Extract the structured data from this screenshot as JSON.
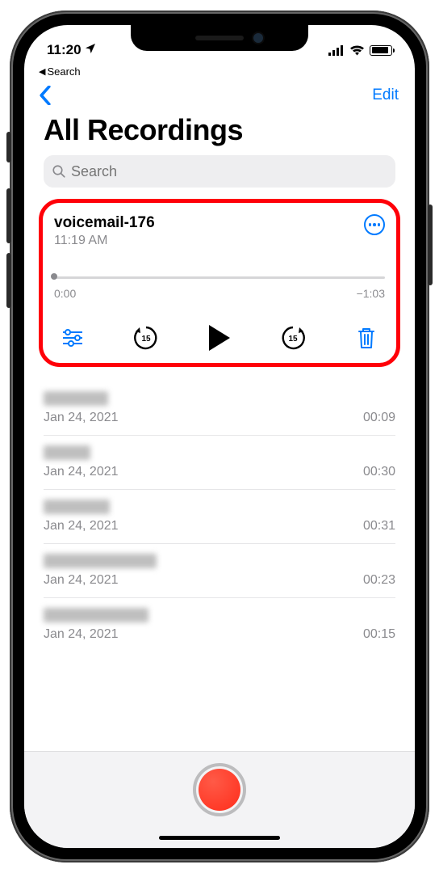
{
  "status": {
    "time": "11:20",
    "breadcrumb": "Search"
  },
  "nav": {
    "edit": "Edit"
  },
  "title": "All Recordings",
  "search": {
    "placeholder": "Search"
  },
  "selected": {
    "title": "voicemail-176",
    "subtitle": "11:19 AM",
    "elapsed": "0:00",
    "remaining": "−1:03"
  },
  "list": [
    {
      "title_width": 80,
      "date": "Jan 24, 2021",
      "duration": "00:09"
    },
    {
      "title_width": 58,
      "date": "Jan 24, 2021",
      "duration": "00:30"
    },
    {
      "title_width": 82,
      "date": "Jan 24, 2021",
      "duration": "00:31"
    },
    {
      "title_width": 140,
      "date": "Jan 24, 2021",
      "duration": "00:23"
    },
    {
      "title_width": 130,
      "date": "Jan 24, 2021",
      "duration": "00:15"
    }
  ]
}
